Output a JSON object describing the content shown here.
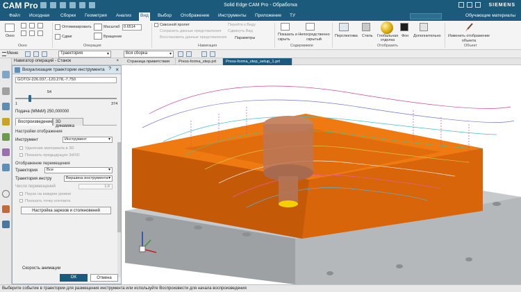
{
  "app": {
    "name": "CAM Pro",
    "window_title": "Solid Edge CAM Pro - Обработка",
    "brand": "SIEMENS"
  },
  "menu": {
    "items": [
      "Файл",
      "Исходная",
      "Сборки",
      "Геометрия",
      "Анализ",
      "Вид",
      "Выбор",
      "Отображение",
      "Инструменты",
      "Приложение",
      "ТУ"
    ],
    "active": "Вид",
    "right_label": "Обучающие материалы"
  },
  "ribbon": {
    "window_group": {
      "label": "Окно",
      "button": "Окно"
    },
    "operation_group": {
      "label": "Операция",
      "fit": "Оптимизировать",
      "shift": "Сдвиг",
      "scale": "Масштаб",
      "rotate": "Вращение",
      "scale_value": "0.6514"
    },
    "navigation_group": {
      "label": "Навигация",
      "items": [
        "Сквозной пролет",
        "Сохранить данные предстваления",
        "Восстановить данные предстваления",
        "Перейти к Виду",
        "Сдвинуть Вид",
        "Параметры"
      ]
    },
    "content_group": {
      "label": "Содержимое",
      "show_hide": "Показать и скрыть",
      "direct_hidden": "Непосредственно скрытый"
    },
    "visual_group": {
      "label": "Отобразить",
      "perspective": "Перспектива",
      "style": "Стиль",
      "global_finish": "Глобальная отделка",
      "background": "Фон",
      "additional": "Дополнительно"
    },
    "object_group": {
      "label": "Объект",
      "edit_object": "Изменить отображение объекта"
    }
  },
  "toolbar2": {
    "menu": "Меню",
    "trajectory_select": "Траектория",
    "assembly_select": "Вся сборка"
  },
  "navigator": {
    "title": "Навигатор операций - Станок"
  },
  "doc_tabs": [
    "Страница приветствия",
    "Press-forma_step.prt",
    "Press-forma_step_setup_1.prt"
  ],
  "dialog": {
    "title": "Визуализация траектории инструмента",
    "goto": "GOTO/-226.037,-120.278,-7.750",
    "slider": {
      "value": "54",
      "min": "1",
      "max": "374",
      "fraction": 0.142
    },
    "feed": "Подача (MMкМ) 250,000000",
    "tabs": [
      "Воспроизведение",
      "3D динамика"
    ],
    "active_tab": "Воспроизведение",
    "display_settings": {
      "title": "Настройки отображения",
      "tool_label": "Инструмент",
      "tool_value": "Инструмент",
      "check1": "Удаление материала в 3D",
      "check2": "Показать предыдущую 3d/3D"
    },
    "motion_display": {
      "title": "Отображение перемещения",
      "trajectories_label": "Траектория",
      "trajectories_value": "Все",
      "tool_traj_label": "Траектория инстру",
      "tool_traj_value": "Вершина инструмента",
      "passes_label": "Число перемещений",
      "passes_value": "1.0",
      "check1": "Пауза на каждом уровне",
      "check2": "Показать точку контакта",
      "button": "Настройка зарезов и столкновений"
    },
    "speed": "Скорость анимации",
    "ok": "OK",
    "cancel": "Отмена"
  },
  "status": "Выберите событие в траектории для размещения инструмента или используйте Воспроизвести для начала воспроизведения",
  "colors": {
    "accent": "#1b5a7a",
    "part": "#f07a12",
    "base": "#b5b8bb"
  }
}
